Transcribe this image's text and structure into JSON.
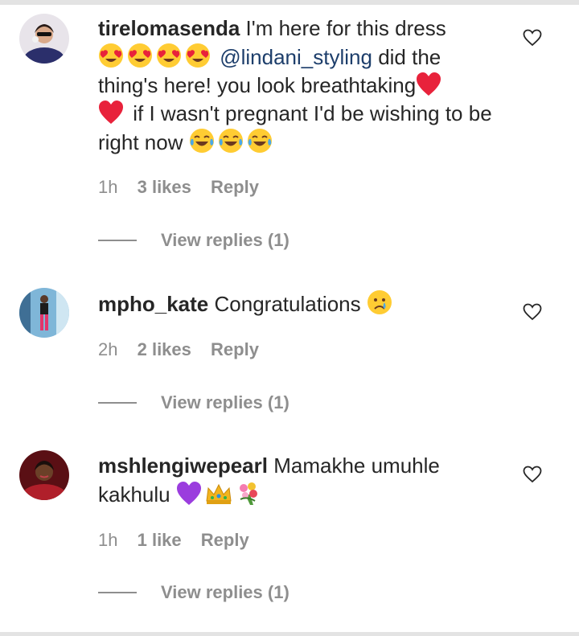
{
  "comments": [
    {
      "username": "tirelomasenda",
      "text_1": "I'm here for this dress",
      "mention": "@lindani_styling",
      "text_2": "did the thing's here! you look breathtaking",
      "text_3": "if I wasn't pregnant I'd be wishing to be right now",
      "time": "1h",
      "likes": "3 likes",
      "reply": "Reply",
      "view_replies": "View replies (1)"
    },
    {
      "username": "mpho_kate",
      "text_1": "Congratulations",
      "time": "2h",
      "likes": "2 likes",
      "reply": "Reply",
      "view_replies": "View replies (1)"
    },
    {
      "username": "mshlengiwepearl",
      "text_1": "Mamakhe umuhle kakhulu",
      "time": "1h",
      "likes": "1 like",
      "reply": "Reply",
      "view_replies": "View replies (1)"
    }
  ],
  "colors": {
    "text": "#262626",
    "muted": "#8e8e8e",
    "mention": "#1d3e6b",
    "divider": "#e3e3e3"
  }
}
